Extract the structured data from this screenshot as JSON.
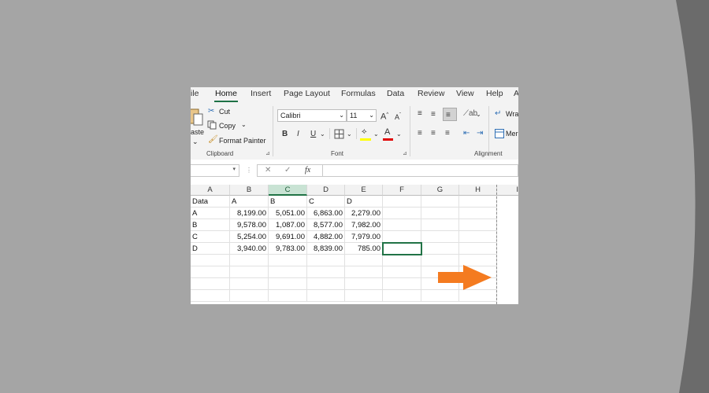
{
  "ribbon_tabs": [
    "ile",
    "Home",
    "Insert",
    "Page Layout",
    "Formulas",
    "Data",
    "Review",
    "View",
    "Help",
    "A"
  ],
  "active_tab": "Home",
  "clipboard": {
    "paste_label": "aste",
    "cut_label": "Cut",
    "copy_label": "Copy",
    "format_painter_label": "Format Painter",
    "group_label": "Clipboard"
  },
  "font": {
    "font_name": "Calibri",
    "font_size": "11",
    "bold_label": "B",
    "italic_label": "I",
    "underline_label": "U",
    "font_color_label": "A",
    "grow_label": "A",
    "shrink_label": "A",
    "group_label": "Font"
  },
  "alignment": {
    "wrap_label": "Wra",
    "merge_label": "Mer",
    "group_label": "Alignment"
  },
  "formula_bar": {
    "fx_label": "fx",
    "cancel_label": "✕",
    "enter_label": "✓",
    "value": ""
  },
  "columns": [
    "A",
    "B",
    "C",
    "D",
    "E",
    "F",
    "G",
    "H",
    "I"
  ],
  "selected_column": "C",
  "rows": [
    [
      "Data",
      "A",
      "B",
      "C",
      "D"
    ],
    [
      "A",
      "8,199.00",
      "5,051.00",
      "6,863.00",
      "2,279.00"
    ],
    [
      "B",
      "9,578.00",
      "1,087.00",
      "8,577.00",
      "7,982.00"
    ],
    [
      "C",
      "5,254.00",
      "9,691.00",
      "4,882.00",
      "7,979.00"
    ],
    [
      "D",
      "3,940.00",
      "9,783.00",
      "8,839.00",
      "785.00"
    ]
  ],
  "colors": {
    "background": "#a5a5a5",
    "accent_green": "#217346",
    "arrow_orange": "#f47b20"
  }
}
